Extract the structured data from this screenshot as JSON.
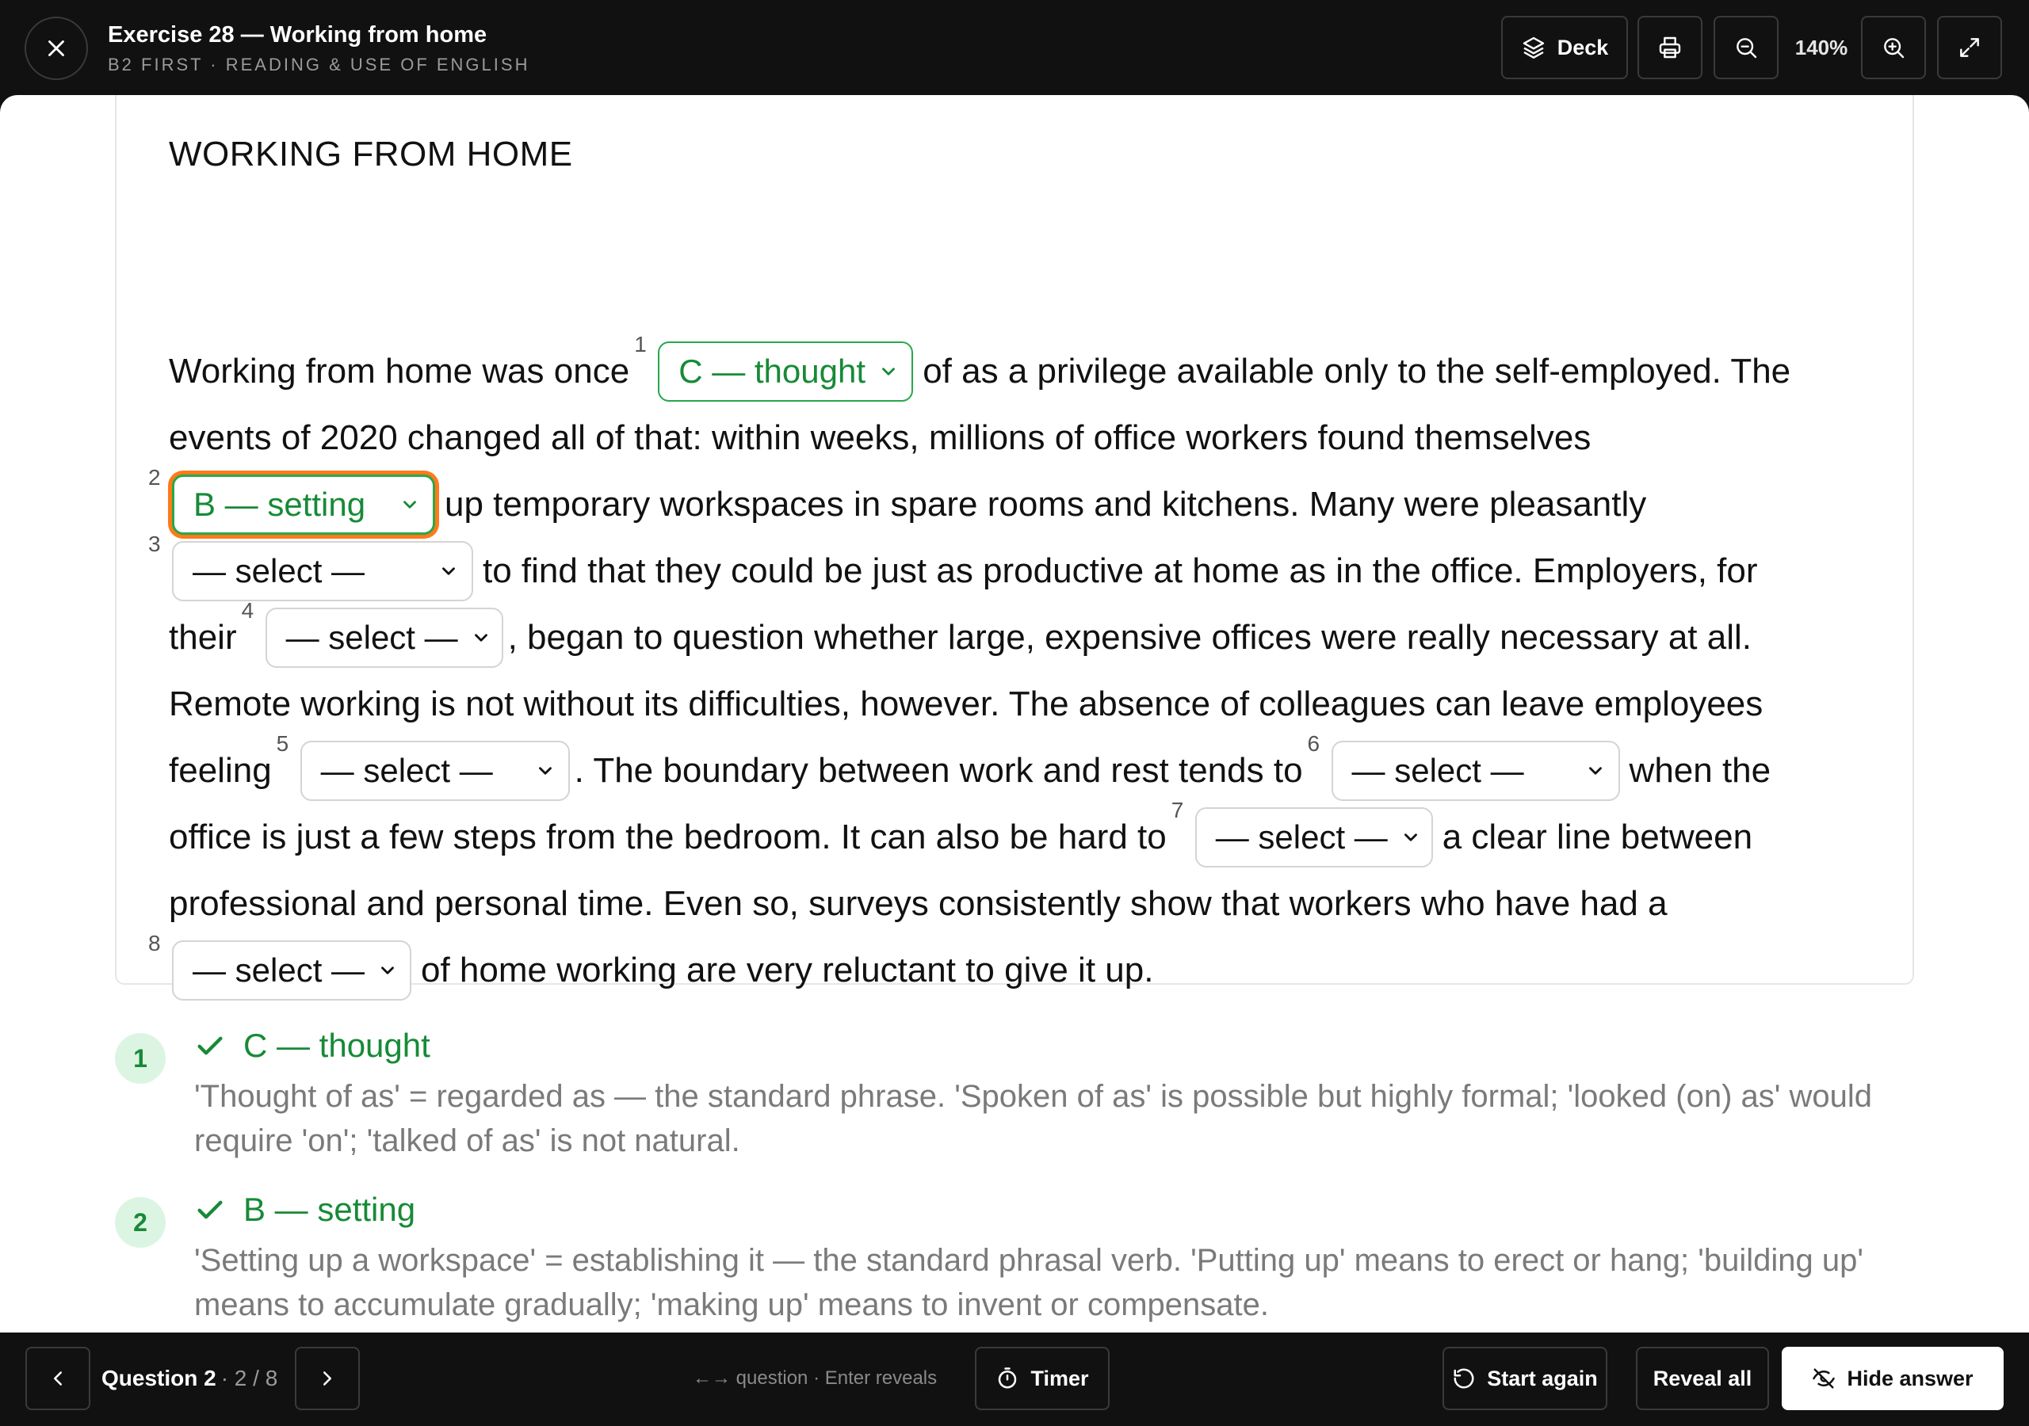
{
  "header": {
    "title": "Exercise 28 — Working from home",
    "subtitle": "B2 FIRST · READING & USE OF ENGLISH",
    "deck_label": "Deck",
    "zoom_level": "140%",
    "icons": [
      "close-icon",
      "layers-icon",
      "printer-icon",
      "zoom-out-icon",
      "zoom-in-icon",
      "expand-icon"
    ]
  },
  "passage": {
    "title": "WORKING FROM HOME",
    "lines": [
      {
        "a": "Working from home was once",
        "b": "of as a privilege available only to the self-employed. The"
      },
      {
        "a": "events of 2020 changed all of that: within weeks, millions of office workers found themselves"
      },
      {
        "b": "up temporary workspaces in spare rooms and kitchens. Many were pleasantly"
      },
      {
        "b": "to find that they could be just as productive at home as in the office. Employers, for"
      },
      {
        "a": "their",
        "b": ", began to question whether large, expensive offices were really necessary at all."
      },
      {
        "a": "Remote working is not without its difficulties, however. The absence of colleagues can leave employees"
      },
      {
        "a": "feeling",
        "b": ". The boundary between work and rest tends to",
        "c": "when the"
      },
      {
        "a": "office is just a few steps from the bedroom. It can also be hard to",
        "b": "a clear line between"
      },
      {
        "a": "professional and personal time. Even so, surveys consistently show that workers who have had a"
      },
      {
        "b": "of home working are very reluctant to give it up."
      }
    ],
    "gaps": [
      {
        "number": "1",
        "value": "C — thought",
        "state": "answered"
      },
      {
        "number": "2",
        "value": "B — setting",
        "state": "answered-focused"
      },
      {
        "number": "3",
        "value": "— select —",
        "state": "empty"
      },
      {
        "number": "4",
        "value": "— select —",
        "state": "empty"
      },
      {
        "number": "5",
        "value": "— select —",
        "state": "empty"
      },
      {
        "number": "6",
        "value": "— select —",
        "state": "empty"
      },
      {
        "number": "7",
        "value": "— select —",
        "state": "empty"
      },
      {
        "number": "8",
        "value": "— select —",
        "state": "empty"
      }
    ]
  },
  "answers": [
    {
      "number": "1",
      "answer": "C — thought",
      "explanation": "'Thought of as' = regarded as — the standard phrase. 'Spoken of as' is possible but highly formal; 'looked (on) as' would require 'on'; 'talked of as' is not natural."
    },
    {
      "number": "2",
      "answer": "B — setting",
      "explanation": "'Setting up a workspace' = establishing it — the standard phrasal verb. 'Putting up' means to erect or hang; 'building up' means to accumulate gradually; 'making up' means to invent or compensate."
    }
  ],
  "footer": {
    "question_label": "Question 2",
    "question_position": "· 2 / 8",
    "hint": "←→ question · Enter reveals",
    "timer_label": "Timer",
    "start_again_label": "Start again",
    "reveal_all_label": "Reveal all",
    "hide_answer_label": "Hide answer"
  },
  "colors": {
    "bar_background": "#111111",
    "correct_green": "#178a37",
    "focus_orange": "#ff7a1a",
    "explanation_gray": "#7a7a7a"
  }
}
